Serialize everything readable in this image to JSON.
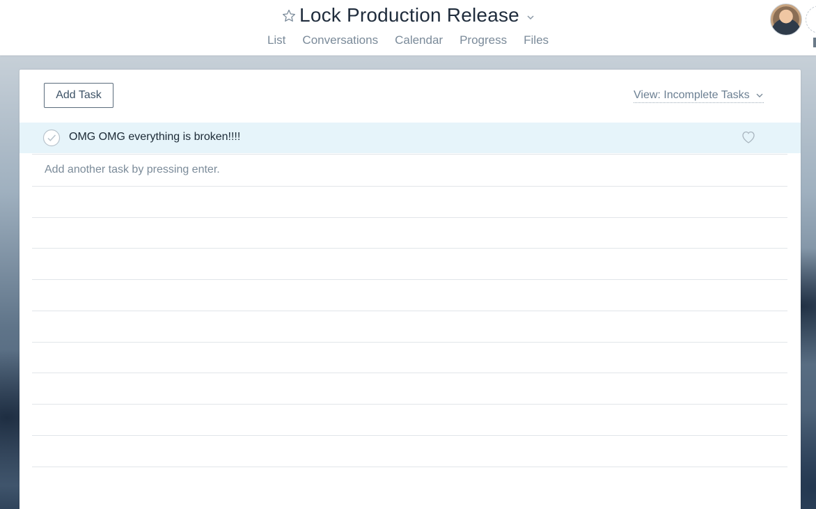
{
  "header": {
    "project_title": "Lock Production Release",
    "tabs": [
      "List",
      "Conversations",
      "Calendar",
      "Progress",
      "Files"
    ],
    "star_icon": "star-icon",
    "chevron_icon": "chevron-down-icon"
  },
  "toolbar": {
    "add_task_label": "Add Task",
    "view_filter_label": "View: Incomplete Tasks"
  },
  "tasks": [
    {
      "name": "OMG OMG everything is broken!!!!",
      "completed": false,
      "liked": false
    }
  ],
  "add_another_placeholder": "Add another task by pressing enter.",
  "colors": {
    "selected_row": "#e6f4fa",
    "title_text": "#1f2c3c",
    "muted_text": "#7a8a99"
  }
}
